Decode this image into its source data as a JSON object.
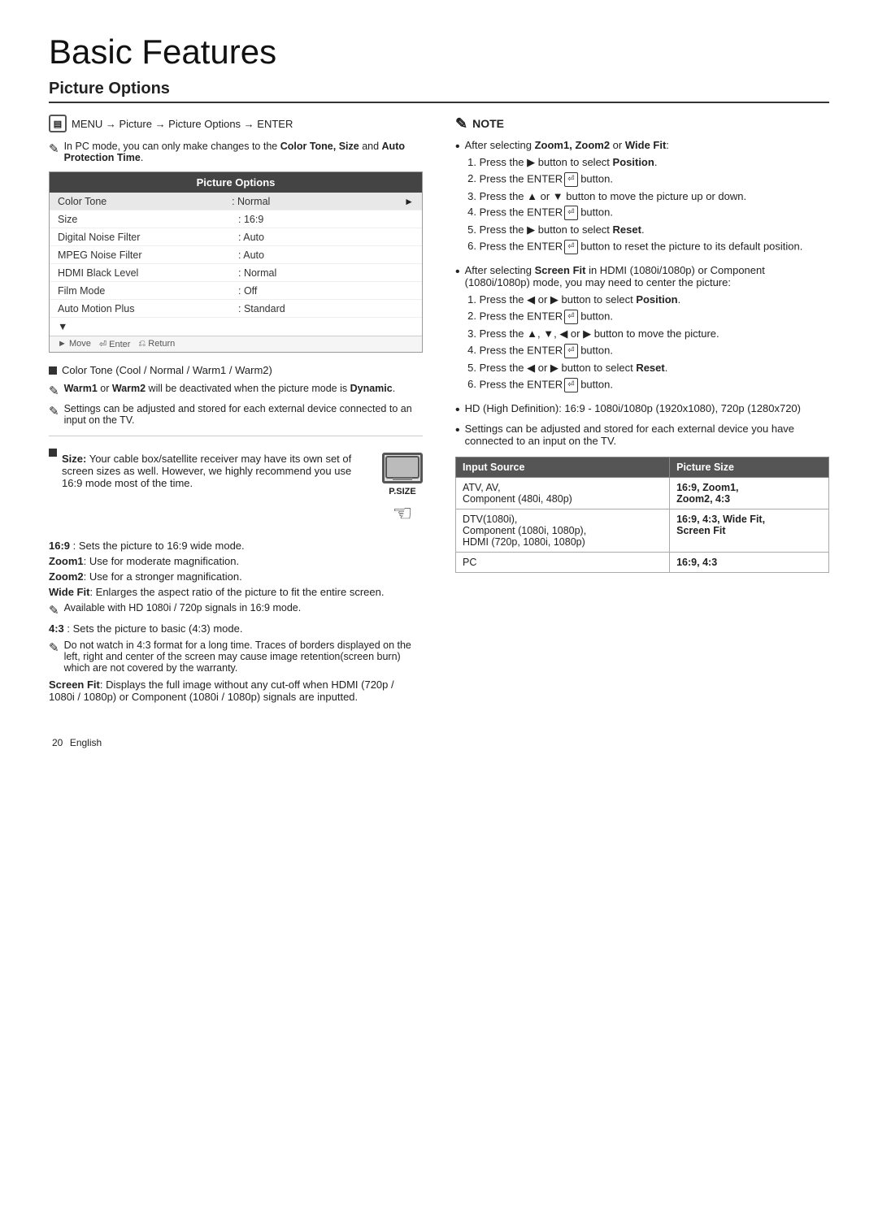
{
  "page": {
    "title": "Basic Features",
    "subtitle": "Picture Options",
    "page_number": "20",
    "page_label": "English"
  },
  "menu_path": "MENU → Picture → Picture Options → ENTER",
  "note_pc_mode": "In PC mode, you can only make changes to the Color Tone, Size and Auto Protection Time.",
  "picture_options_table": {
    "header": "Picture Options",
    "rows": [
      {
        "label": "Color Tone",
        "value": ": Normal",
        "highlighted": true,
        "has_arrow": true
      },
      {
        "label": "Size",
        "value": ": 16:9",
        "highlighted": false
      },
      {
        "label": "Digital Noise Filter",
        "value": ": Auto",
        "highlighted": false
      },
      {
        "label": "MPEG Noise Filter",
        "value": ": Auto",
        "highlighted": false
      },
      {
        "label": "HDMI Black Level",
        "value": ": Normal",
        "highlighted": false
      },
      {
        "label": "Film Mode",
        "value": ": Off",
        "highlighted": false
      },
      {
        "label": "Auto Motion Plus",
        "value": ": Standard",
        "highlighted": false
      }
    ],
    "footer": {
      "move": "Move",
      "enter": "Enter",
      "return": "Return"
    }
  },
  "color_tone_bullet": "Color Tone (Cool / Normal / Warm1 / Warm2)",
  "warm_note": "Warm1 or Warm2 will be deactivated when the picture mode is Dynamic.",
  "settings_note": "Settings can be adjusted and stored for each external device connected to an input on the TV.",
  "size_bullet": "Size: Your cable box/satellite receiver may have its own set of screen sizes as well. However, we highly recommend you use 16:9 mode most of the time.",
  "psize_label": "P.SIZE",
  "size_169": "16:9 : Sets the picture to 16:9 wide mode.",
  "size_zoom1": "Zoom1: Use for moderate magnification.",
  "size_zoom2": "Zoom2: Use for a stronger magnification.",
  "size_wide_fit": "Wide Fit: Enlarges the aspect ratio of the picture to fit the entire screen.",
  "size_hd_note": "Available with HD 1080i / 720p signals in 16:9 mode.",
  "size_43": "4:3 : Sets the picture to basic (4:3) mode.",
  "size_43_note": "Do not watch in 4:3 format for a long time. Traces of borders displayed on the left, right and center of the screen may cause image retention(screen burn) which are not covered by the warranty.",
  "screen_fit": "Screen Fit: Displays the full image without any cut-off when HDMI (720p / 1080i / 1080p) or Component (1080i / 1080p) signals are inputted.",
  "note_section": {
    "header": "NOTE",
    "after_zoom_header": "After selecting Zoom1, Zoom2 or Wide Fit:",
    "zoom_steps": [
      "Press the ▶ button to select Position.",
      "Press the ENTER button.",
      "Press the ▲ or ▼ button to move the picture up or down.",
      "Press the ENTER button.",
      "Press the ▶ button to select Reset.",
      "Press the ENTER button to reset the picture to its default position."
    ],
    "after_screen_fit_header": "After selecting Screen Fit in HDMI (1080i/1080p) or Component (1080i/1080p) mode, you may need to center the picture:",
    "screen_fit_steps": [
      "Press the ◀ or ▶ button to select Position.",
      "Press the ENTER button.",
      "Press the ▲, ▼, ◀ or ▶ button to move the picture.",
      "Press the ENTER button.",
      "Press the ◀ or ▶ button to select Reset.",
      "Press the ENTER button."
    ],
    "hd_note": "HD (High Definition): 16:9 - 1080i/1080p (1920x1080), 720p (1280x720)",
    "settings_note2": "Settings can be adjusted and stored for each external device you have connected to an input on the TV."
  },
  "input_table": {
    "headers": [
      "Input Source",
      "Picture Size"
    ],
    "rows": [
      {
        "source": "ATV, AV,\nComponent (480i, 480p)",
        "size": "16:9, Zoom1,\nZoom2, 4:3"
      },
      {
        "source": "DTV(1080i),\nComponent (1080i, 1080p),\nHDMI (720p, 1080i, 1080p)",
        "size": "16:9, 4:3, Wide Fit,\nScreen Fit"
      },
      {
        "source": "PC",
        "size": "16:9, 4:3"
      }
    ]
  }
}
